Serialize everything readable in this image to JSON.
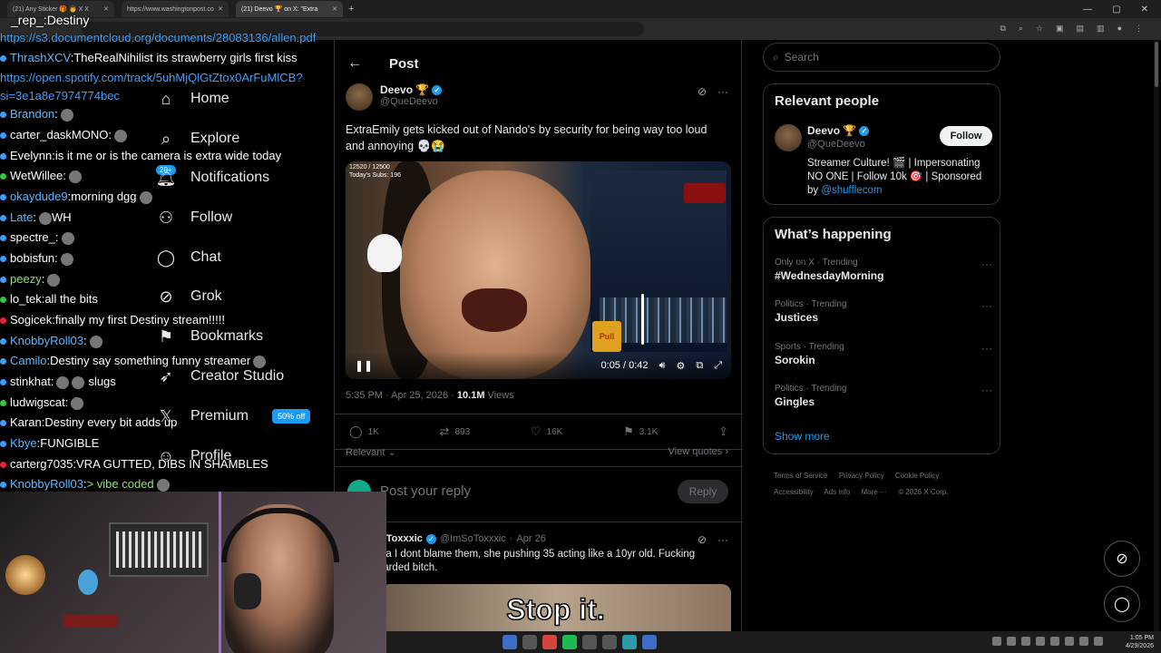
{
  "browser": {
    "tabs": [
      {
        "label": "(21) Any Sticker 🎁 👨 X X",
        "active": false
      },
      {
        "label": "https://www.washingtonpost.co",
        "active": false
      },
      {
        "label": "(21) Deevo 🏆 on X: \"Extra",
        "active": true
      }
    ],
    "url": "https://s3.documentcloud.org/documents/28083136/allen.pdf",
    "window_buttons": [
      "—",
      "▢",
      "✕"
    ]
  },
  "chat": {
    "title": "_rep_:Destiny",
    "link_line": "https://s3.documentcloud.org/documents/28083136/allen.pdf",
    "messages": [
      {
        "user": "ThrashXCV",
        "text": "TheRealNihilist its strawberry girls first kiss",
        "color": "blue",
        "dot": "blue"
      },
      {
        "user": "",
        "text": "https://open.spotify.com/track/5uhMjQlGtZtox0ArFuMlCB?si=3e1a8e7974774bec",
        "color": "link",
        "dot": ""
      },
      {
        "user": "Brandon",
        "text": "",
        "color": "blue",
        "dot": "blue"
      },
      {
        "user": "carter_dask",
        "text": "MONO:",
        "color": "white",
        "dot": "blue"
      },
      {
        "user": "Evelynn",
        "text": "is it me or is the camera is extra wide today",
        "color": "white",
        "dot": "blue"
      },
      {
        "user": "WetWillee",
        "text": "",
        "color": "white",
        "dot": "green"
      },
      {
        "user": "okaydude9",
        "text": "morning dgg",
        "color": "blue",
        "dot": "blue"
      },
      {
        "user": "Late",
        "text": "WH",
        "color": "blue",
        "dot": "blue"
      },
      {
        "user": "spectre_",
        "text": "",
        "color": "white",
        "dot": "blue"
      },
      {
        "user": "bobisfun",
        "text": "",
        "color": "white",
        "dot": "blue"
      },
      {
        "user": "peezy",
        "text": "",
        "color": "green",
        "dot": "blue"
      },
      {
        "user": "lo_tek",
        "text": "all the bits",
        "color": "white",
        "dot": "green"
      },
      {
        "user": "Sogicek",
        "text": "finally my first Destiny stream!!!!!",
        "color": "white",
        "dot": "red"
      },
      {
        "user": "KnobbyRoll03",
        "text": "",
        "color": "blue",
        "dot": "blue"
      },
      {
        "user": "Camilo",
        "text": "Destiny say something funny streamer",
        "color": "blue",
        "dot": "blue"
      },
      {
        "user": "stinkhat",
        "text": "slugs",
        "color": "white",
        "dot": "blue"
      },
      {
        "user": "ludwigscat",
        "text": "",
        "color": "white",
        "dot": "green"
      },
      {
        "user": "Karan",
        "text": "Destiny every bit adds up",
        "color": "white",
        "dot": "blue"
      },
      {
        "user": "Kbye",
        "text": "FUNGIBLE",
        "color": "blue",
        "dot": "blue"
      },
      {
        "user": "carterg7035",
        "text": "VRA GUTTED, DIBS IN SHAMBLES",
        "color": "white",
        "dot": "red"
      },
      {
        "user": "KnobbyRoll03",
        "text": "> vibe coded",
        "color": "blue",
        "dot": "blue"
      }
    ]
  },
  "xnav": {
    "items": [
      {
        "label": "Home",
        "icon": "home-icon"
      },
      {
        "label": "Explore",
        "icon": "search-icon"
      },
      {
        "label": "Notifications",
        "icon": "bell-icon"
      },
      {
        "label": "Follow",
        "icon": "person-plus-icon"
      },
      {
        "label": "Chat",
        "icon": "chat-icon"
      },
      {
        "label": "Grok",
        "icon": "grok-icon"
      },
      {
        "label": "Bookmarks",
        "icon": "bookmark-icon"
      },
      {
        "label": "Creator Studio",
        "icon": "rocket-icon"
      },
      {
        "label": "Premium",
        "icon": "x-logo-icon"
      },
      {
        "label": "Profile",
        "icon": "person-icon"
      }
    ],
    "notif_badge": "20+",
    "premium_badge": "50% off"
  },
  "post": {
    "header_title": "Post",
    "author_name": "Deevo 🏆",
    "author_handle": "@QueDeevo",
    "text": "ExtraEmily gets kicked out of Nando's by security for being way too loud and annoying 💀😭",
    "video": {
      "time": "0:05 / 0:42",
      "progress": 0.12,
      "counter_line1": "12520 / 12500",
      "counter_line2": "Today's Subs: 196",
      "sign": "Pull"
    },
    "time": "5:35 PM · Apr 25, 2026 · ",
    "views_count": "10.1M",
    "views_label": " Views",
    "replies": "1K",
    "reposts": "893",
    "likes": "16K",
    "bookmarks": "3.1K",
    "sort_label": "Relevant",
    "view_quotes": "View quotes",
    "reply_placeholder": "Post your reply",
    "reply_button": "Reply"
  },
  "comment": {
    "name": "ImSoToxxxic",
    "display_name": "oToxxxic",
    "handle": "@ImSoToxxxic",
    "date": "Apr 26",
    "text": "ea I dont blame them, she pushing 35 acting like a 10yr old. Fucking tarded bitch.",
    "caption": "Stop it."
  },
  "sidebar": {
    "search_placeholder": "Search",
    "relevant_title": "Relevant people",
    "rp_name": "Deevo 🏆",
    "rp_handle": "@QueDeevo",
    "follow_label": "Follow",
    "rp_bio": "Streamer Culture! 🎬 | Impersonating NO ONE | Follow 10k 🎯 | Sponsored by ",
    "rp_bio_link": "@shufflecom",
    "happening_title": "What’s happening",
    "trends": [
      {
        "category": "Only on X · Trending",
        "topic": "#WednesdayMorning"
      },
      {
        "category": "Politics · Trending",
        "topic": "Justices"
      },
      {
        "category": "Sports · Trending",
        "topic": "Sorokin"
      },
      {
        "category": "Politics · Trending",
        "topic": "Gingles"
      }
    ],
    "show_more": "Show more",
    "footer": [
      "Terms of Service",
      "Privacy Policy",
      "Cookie Policy",
      "Accessibility",
      "Ads info",
      "More ···",
      "© 2026 X Corp."
    ]
  },
  "taskbar": {
    "time": "1:05 PM",
    "date": "4/29/2026"
  }
}
